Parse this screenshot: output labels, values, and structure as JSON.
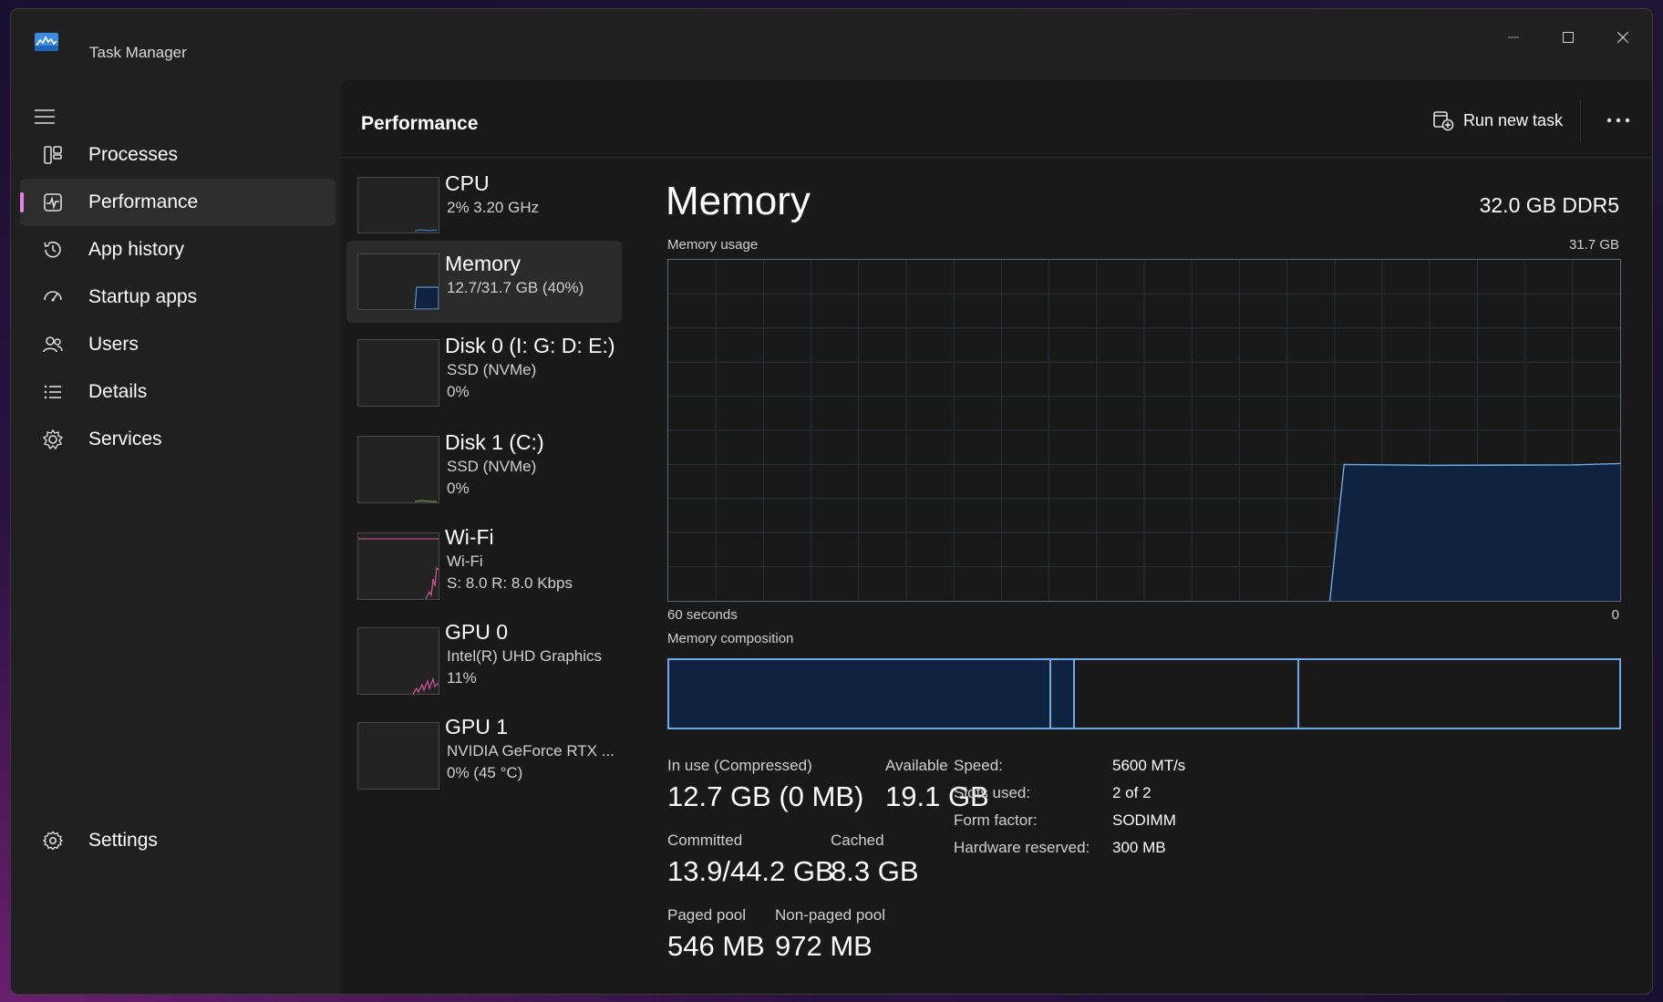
{
  "window": {
    "title": "Task Manager"
  },
  "nav": {
    "items": [
      {
        "label": "Processes",
        "icon": "processes-icon"
      },
      {
        "label": "Performance",
        "icon": "performance-icon",
        "active": true
      },
      {
        "label": "App history",
        "icon": "history-icon"
      },
      {
        "label": "Startup apps",
        "icon": "startup-icon"
      },
      {
        "label": "Users",
        "icon": "users-icon"
      },
      {
        "label": "Details",
        "icon": "details-icon"
      },
      {
        "label": "Services",
        "icon": "services-icon"
      }
    ],
    "settings_label": "Settings"
  },
  "header": {
    "title": "Performance",
    "run_task_label": "Run new task"
  },
  "devices": [
    {
      "name": "CPU",
      "sub1": "2%  3.20 GHz",
      "sub2": ""
    },
    {
      "name": "Memory",
      "sub1": "12.7/31.7 GB (40%)",
      "sub2": "",
      "active": true
    },
    {
      "name": "Disk 0 (I: G: D: E:)",
      "sub1": "SSD (NVMe)",
      "sub2": "0%"
    },
    {
      "name": "Disk 1 (C:)",
      "sub1": "SSD (NVMe)",
      "sub2": "0%"
    },
    {
      "name": "Wi-Fi",
      "sub1": "Wi-Fi",
      "sub2": "S: 8.0  R: 8.0 Kbps"
    },
    {
      "name": "GPU 0",
      "sub1": "Intel(R) UHD Graphics",
      "sub2": "11%"
    },
    {
      "name": "GPU 1",
      "sub1": "NVIDIA GeForce RTX ...",
      "sub2": "0%  (45 °C)"
    }
  ],
  "memory": {
    "title": "Memory",
    "type": "32.0 GB DDR5",
    "usage_label": "Memory usage",
    "usage_max": "31.7 GB",
    "time_left": "60 seconds",
    "time_right": "0",
    "usage_fraction": 0.4,
    "composition_label": "Memory composition",
    "stats": {
      "in_use_label": "In use (Compressed)",
      "in_use_value": "12.7 GB (0 MB)",
      "available_label": "Available",
      "available_value": "19.1 GB",
      "committed_label": "Committed",
      "committed_value": "13.9/44.2 GB",
      "cached_label": "Cached",
      "cached_value": "8.3 GB",
      "paged_label": "Paged pool",
      "paged_value": "546 MB",
      "nonpaged_label": "Non-paged pool",
      "nonpaged_value": "972 MB"
    },
    "specs": [
      {
        "key": "Speed:",
        "value": "5600 MT/s"
      },
      {
        "key": "Slots used:",
        "value": "2 of 2"
      },
      {
        "key": "Form factor:",
        "value": "SODIMM"
      },
      {
        "key": "Hardware reserved:",
        "value": "300 MB"
      }
    ]
  },
  "colors": {
    "accent": "#e880e8",
    "memory_line": "#6fa8e8",
    "memory_fill": "#0f2240",
    "wifi_line": "#d4559c",
    "background": "#191919"
  }
}
